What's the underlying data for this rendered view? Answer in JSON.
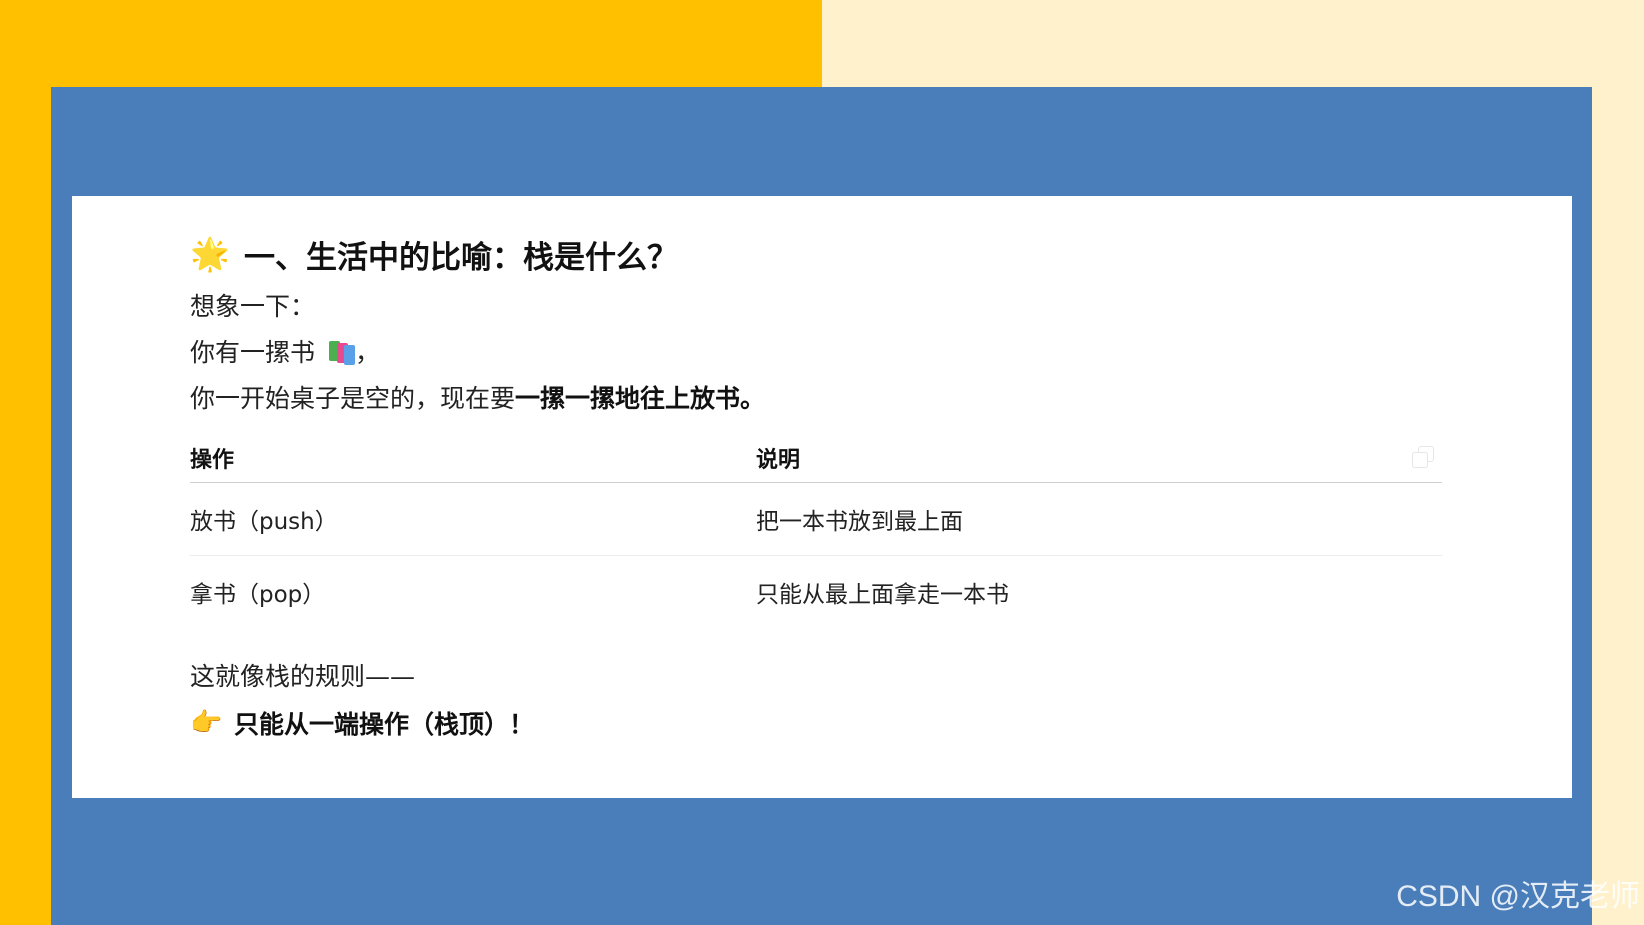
{
  "heading": {
    "icon": "sparkle-star-icon",
    "icon_glyph": "🌟",
    "text": "一、生活中的比喻：栈是什么？"
  },
  "intro": {
    "line1": "想象一下：",
    "line2_text": "你有一摞书",
    "line2_icon": "books-icon",
    "line2_suffix": "，",
    "line3_prefix": "你一开始桌子是空的，现在要",
    "line3_bold": "一摞一摞地往上放书。"
  },
  "table": {
    "headers": [
      "操作",
      "说明"
    ],
    "rows": [
      [
        "放书（push）",
        "把一本书放到最上面"
      ],
      [
        "拿书（pop）",
        "只能从最上面拿走一本书"
      ]
    ],
    "copy_icon": "copy-icon"
  },
  "rule": {
    "line": "这就像栈的规则——",
    "final_icon": "pointing-hand-icon",
    "final_glyph": "👉",
    "final_text": "只能从一端操作（栈顶）！"
  },
  "watermark": "CSDN @汉克老师",
  "colors": {
    "left_bg": "#FFC000",
    "right_bg": "#FFF1CC",
    "panel": "#4A7EBB",
    "card": "#FFFFFF"
  }
}
